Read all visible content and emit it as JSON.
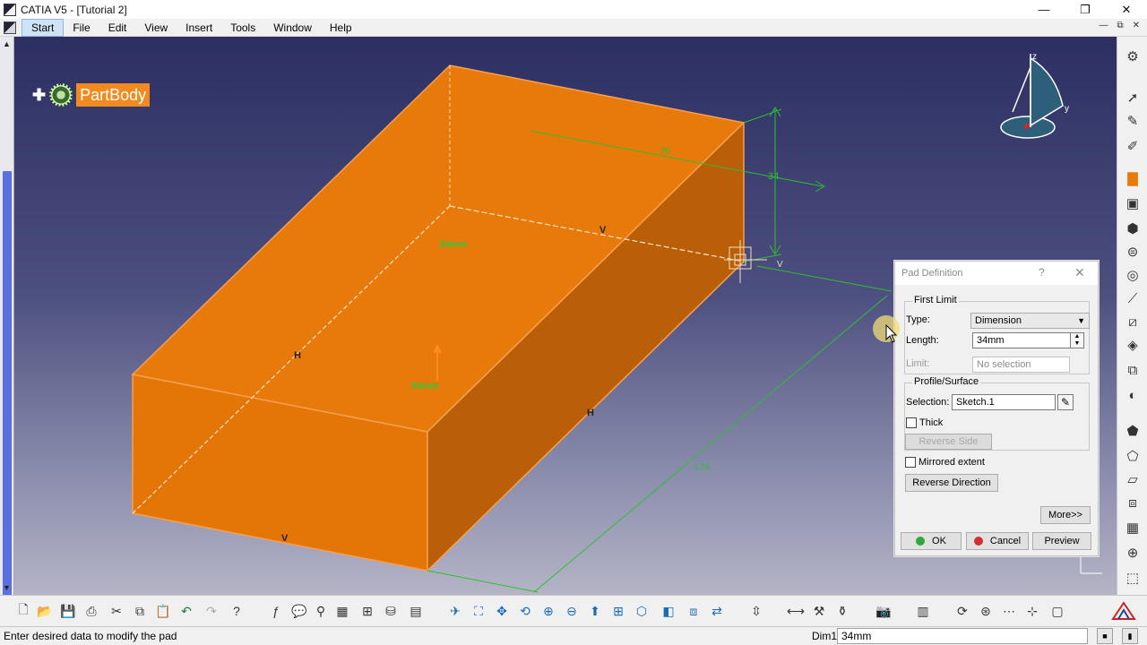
{
  "window": {
    "title": "CATIA V5 - [Tutorial 2]",
    "controls": [
      "—",
      "❐",
      "✕"
    ]
  },
  "menu": {
    "items": [
      {
        "label": "Start",
        "key": "S"
      },
      {
        "label": "File",
        "key": "F"
      },
      {
        "label": "Edit",
        "key": "E"
      },
      {
        "label": "View",
        "key": "V"
      },
      {
        "label": "Insert",
        "key": "I"
      },
      {
        "label": "Tools",
        "key": "T"
      },
      {
        "label": "Window",
        "key": "W"
      },
      {
        "label": "Help",
        "key": "H"
      }
    ],
    "mdi_controls": [
      "—",
      "⧉",
      "✕"
    ]
  },
  "tree": {
    "root_label": "PartBody"
  },
  "viewport": {
    "compass": {
      "z": "z",
      "y": "y"
    },
    "dimensions": {
      "height": "34",
      "length": "76",
      "width": "174"
    },
    "pad_labels": [
      "34mm",
      "34mm"
    ],
    "markers": {
      "v1": "V",
      "v2": "V",
      "h1": "H",
      "h2": "H",
      "v3": "V"
    }
  },
  "dialog": {
    "title": "Pad Definition",
    "help": "?",
    "close": "✕",
    "first_limit": {
      "legend": "First Limit",
      "type_label": "Type:",
      "type_value": "Dimension",
      "length_label": "Length:",
      "length_value": "34mm",
      "limit_label": "Limit:",
      "limit_value": "No selection"
    },
    "profile": {
      "legend": "Profile/Surface",
      "selection_label": "Selection:",
      "selection_value": "Sketch.1",
      "thick_label": "Thick",
      "reverse_side": "Reverse Side"
    },
    "mirrored_label": "Mirrored extent",
    "reverse_direction": "Reverse Direction",
    "more": "More>>",
    "ok": "OK",
    "cancel": "Cancel",
    "preview": "Preview"
  },
  "status": {
    "message": "Enter desired data to modify the pad",
    "dim_label": "Dim1",
    "dim_value": "34mm"
  },
  "colors": {
    "solid": "#e87a0c",
    "solid_dark": "#b95d08",
    "dimension": "#2fbf2f",
    "background_top": "#2d2f62",
    "partbody_bg": "#f18a1f"
  },
  "icons": {
    "right_toolbar": [
      "compass-icon",
      "select-icon",
      "sketch-icon",
      "pad-icon",
      "pocket-icon",
      "shaft-icon",
      "groove-icon",
      "hole-icon",
      "rib-icon",
      "slot-icon",
      "stiffener-icon",
      "multisection-icon",
      "removed-multisection-icon",
      "fillet-icon",
      "chamfer-icon",
      "draft-icon",
      "shell-icon",
      "thickness-icon",
      "thread-icon",
      "axis-system-icon",
      "other-icon"
    ],
    "bottom_toolbar": [
      "new-icon",
      "open-icon",
      "save-icon",
      "print-icon",
      "cut-icon",
      "copy-icon",
      "paste-icon",
      "undo-icon",
      "redo-icon",
      "whats-this-icon",
      "formula-icon",
      "comment-icon",
      "knowledge-icon",
      "table-icon",
      "catalog-icon",
      "measure-icon",
      "apply-material-icon",
      "fly-mode-icon",
      "fit-all-icon",
      "pan-icon",
      "rotate-icon",
      "zoom-in-icon",
      "zoom-out-icon",
      "normal-view-icon",
      "multi-view-icon",
      "iso-view-icon",
      "shading-icon",
      "hide-show-icon",
      "swap-icon",
      "3d-compass-icon",
      "constraint-icon",
      "analysis-icon",
      "render-icon",
      "grid-icon",
      "update-icon",
      "body-icon",
      "sketcher-icon",
      "3d-view-icon"
    ]
  }
}
